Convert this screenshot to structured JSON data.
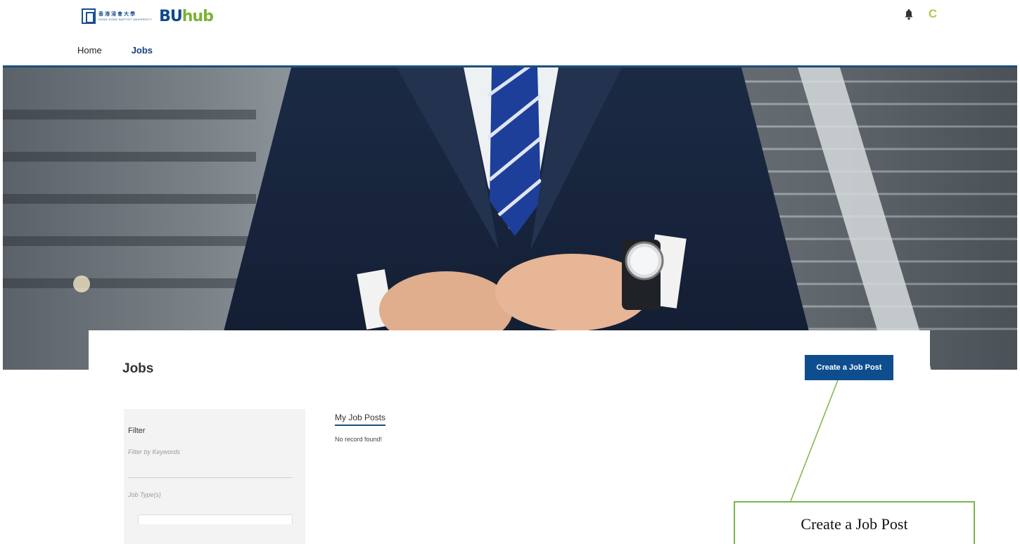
{
  "header": {
    "logo_cn": "香港浸會大學",
    "logo_en": "HONG KONG BAPTIST UNIVERSITY",
    "brand_bu": "BU",
    "brand_hub": "hub",
    "avatar_letter": "C"
  },
  "nav": {
    "items": [
      {
        "label": "Home",
        "active": false
      },
      {
        "label": "Jobs",
        "active": true
      }
    ]
  },
  "main": {
    "page_title": "Jobs",
    "create_button_label": "Create a Job Post"
  },
  "filter": {
    "title": "Filter",
    "keyword_placeholder": "Filter by Keywords",
    "job_type_label": "Job Type(s)"
  },
  "listing": {
    "tab_label": "My Job Posts",
    "empty_message": "No record found!"
  },
  "annotation": {
    "label": "Create a Job Post"
  },
  "colors": {
    "primary": "#0f4e8e",
    "brand_green": "#7ab333",
    "callout_green": "#7ab648",
    "nav_rule": "#1c4e7e"
  }
}
